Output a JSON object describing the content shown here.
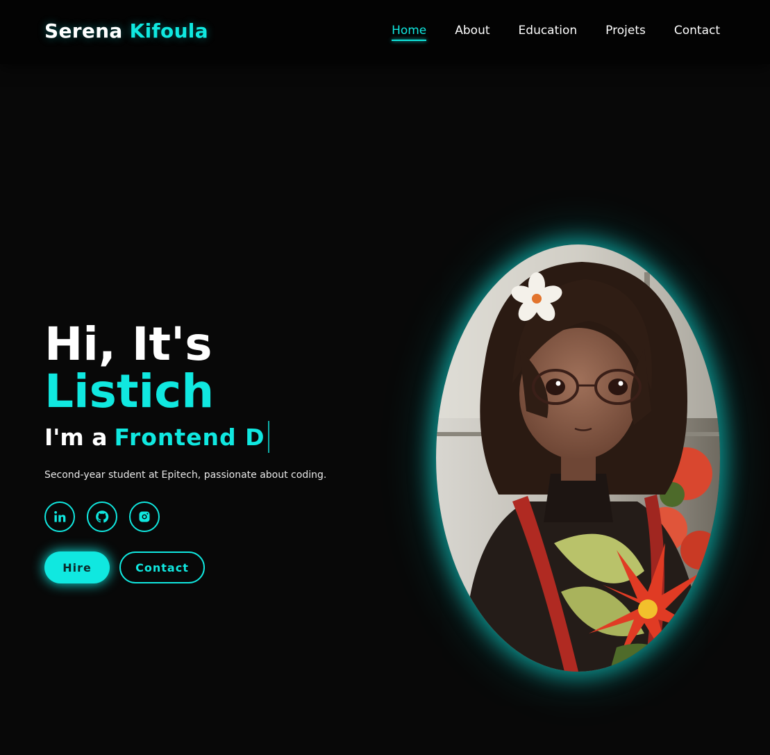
{
  "brand": {
    "first": "Serena",
    "last": "Kifoula"
  },
  "nav": {
    "items": [
      {
        "label": "Home",
        "active": true
      },
      {
        "label": "About"
      },
      {
        "label": "Education"
      },
      {
        "label": "Projets"
      },
      {
        "label": "Contact"
      }
    ]
  },
  "hero": {
    "greeting": "Hi, It's",
    "name": "Listich",
    "role_prefix": "I'm a",
    "role_typed": "Frontend D",
    "description": "Second-year student at Epitech, passionate about coding.",
    "socials": [
      {
        "icon": "linkedin-icon"
      },
      {
        "icon": "github-icon"
      },
      {
        "icon": "instagram-icon"
      }
    ],
    "hire_label": "Hire",
    "contact_label": "Contact"
  },
  "colors": {
    "accent": "#10e8e0",
    "background": "#080808",
    "header": "#030303"
  }
}
